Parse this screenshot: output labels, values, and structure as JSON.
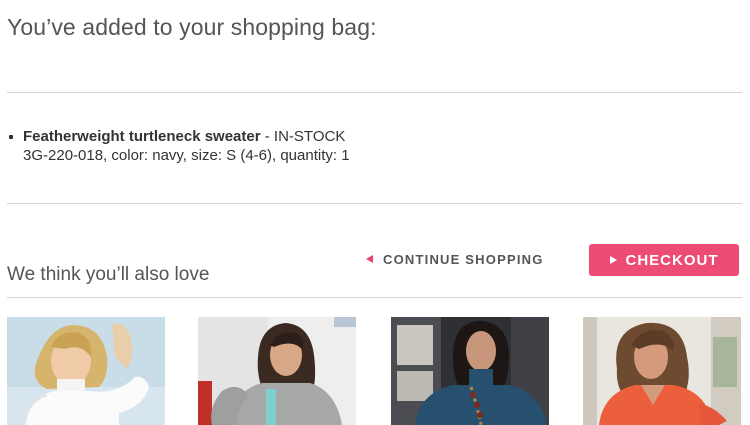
{
  "header": {
    "title": "You’ve added to your shopping bag:"
  },
  "cart_item": {
    "name": "Featherweight turtleneck sweater",
    "separator": " - ",
    "stock_status": "IN-STOCK",
    "details": "3G-220-018, color: navy, size: S (4-6), quantity: 1"
  },
  "recommendations": {
    "title": "We think you’ll also love",
    "products": [
      {
        "icon": "white-turtleneck-product-image"
      },
      {
        "icon": "gray-sweater-product-image"
      },
      {
        "icon": "navy-turtleneck-product-image"
      },
      {
        "icon": "coral-vneck-product-image"
      }
    ]
  },
  "actions": {
    "continue_label": "CONTINUE SHOPPING",
    "checkout_label": "CHECKOUT"
  },
  "colors": {
    "accent": "#ec4b73",
    "arrow": "#e8416f",
    "divider": "#d6d6d6"
  }
}
